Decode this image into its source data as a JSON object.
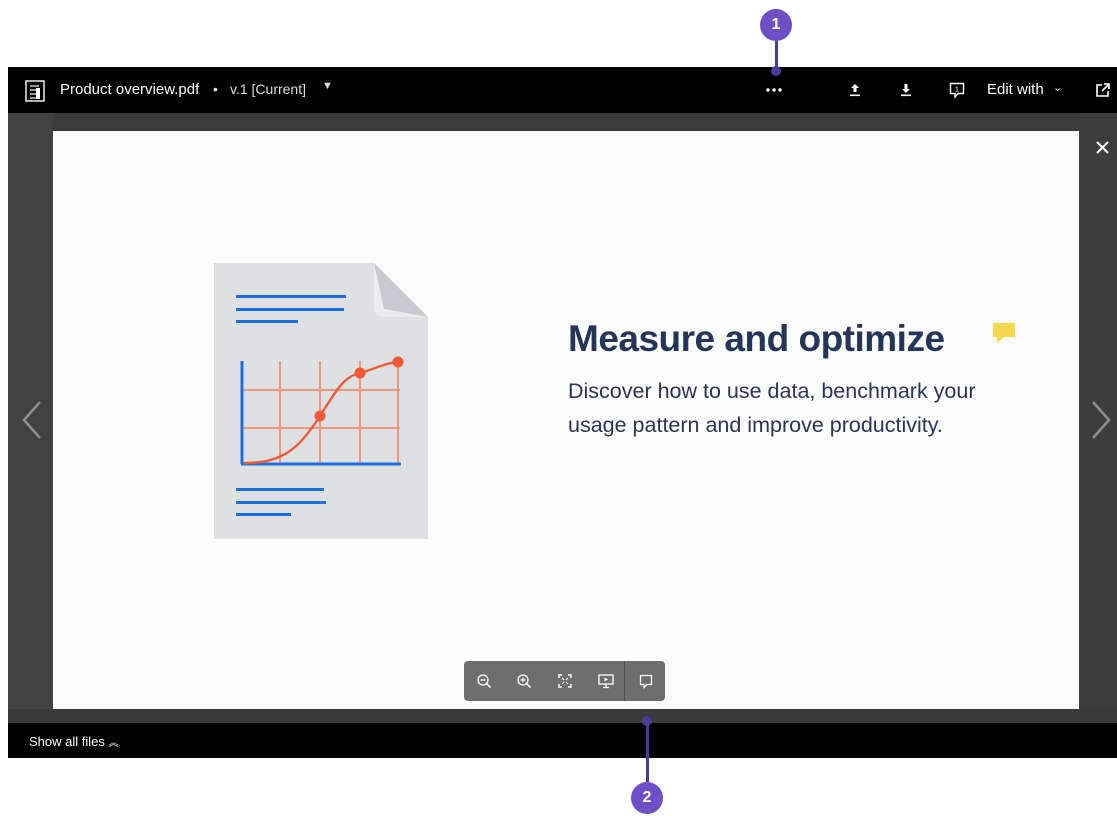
{
  "header": {
    "file_name": "Product overview.pdf",
    "separator": "•",
    "version": "v.1 [Current]",
    "edit_with": "Edit with"
  },
  "slide": {
    "headline": "Measure and optimize",
    "body": "Discover how to use data, benchmark your usage pattern and improve productivity."
  },
  "footer": {
    "show_all_files": "Show all files"
  },
  "callouts": {
    "one": "1",
    "two": "2"
  },
  "icons": {
    "file": "file-icon",
    "more": "more-icon",
    "upload": "upload-icon",
    "download": "download-icon",
    "comment": "comment-icon",
    "open_external": "open-external-icon",
    "close": "close-icon",
    "prev": "chevron-left-icon",
    "next": "chevron-right-icon",
    "zoom_out": "zoom-out-icon",
    "zoom_in": "zoom-in-icon",
    "fit": "fit-screen-icon",
    "present": "present-icon",
    "annotate": "annotate-icon"
  },
  "colors": {
    "callout": "#6f4fc6",
    "headline": "#243557",
    "chart_line": "#f05a37",
    "accent_blue": "#1f6fe0",
    "speech_yellow": "#f7d74e"
  }
}
